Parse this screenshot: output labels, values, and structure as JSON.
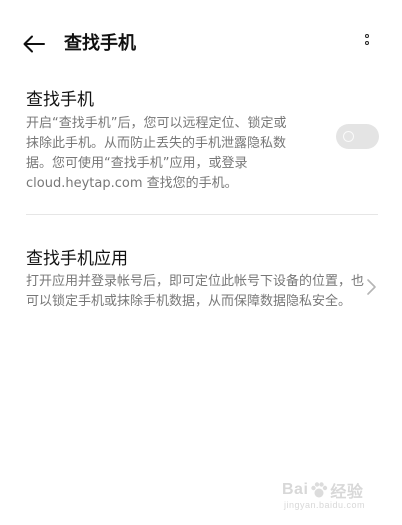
{
  "header": {
    "title": "查找手机",
    "back_icon": "arrow-left-icon",
    "more_icon": "more-vertical-icon"
  },
  "find_phone": {
    "title": "查找手机",
    "description": "开启“查找手机”后，您可以远程定位、锁定或抹除此手机。从而防止丢失的手机泄露隐私数据。您可使用“查找手机”应用，或登录 cloud.heytap.com 查找您的手机。",
    "toggle_on": false
  },
  "find_phone_app": {
    "title": "查找手机应用",
    "description": "打开应用并登录帐号后，即可定位此帐号下设备的位置，也可以锁定手机或抹除手机数据，从而保障数据隐私安全。",
    "chevron_icon": "chevron-right-icon"
  },
  "watermark": {
    "left": "Bai",
    "right": "经验",
    "sub": "jingyan.baidu.com"
  }
}
